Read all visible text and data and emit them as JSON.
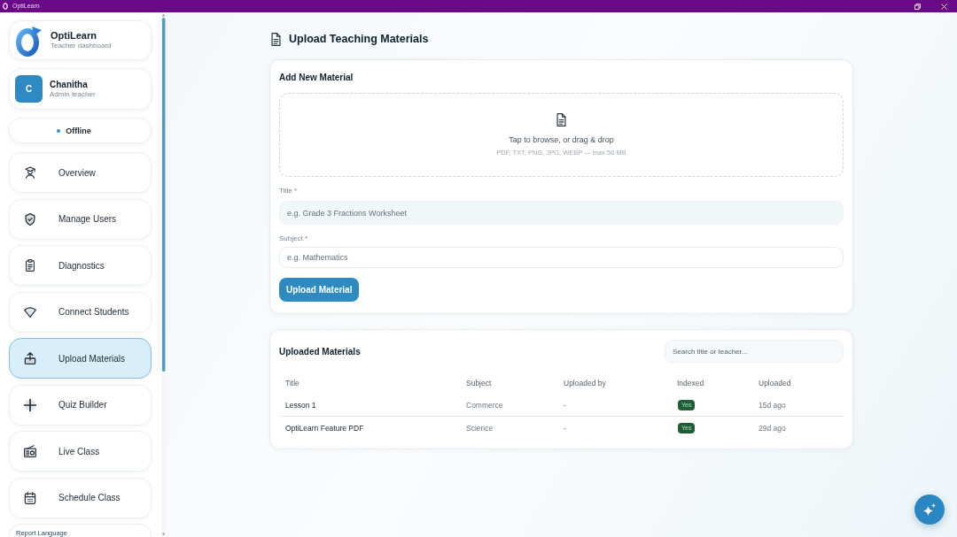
{
  "window": {
    "title": "OptiLearn"
  },
  "sidebar": {
    "brand": {
      "name": "OptiLearn",
      "subtitle": "Teacher dashboard"
    },
    "user": {
      "initial": "C",
      "name": "Chanitha",
      "role": "Admin teacher"
    },
    "status": {
      "label": "Offline"
    },
    "items": [
      {
        "label": "Overview",
        "selected": false
      },
      {
        "label": "Manage Users",
        "selected": false
      },
      {
        "label": "Diagnostics",
        "selected": false
      },
      {
        "label": "Connect Students",
        "selected": false
      },
      {
        "label": "Upload Materials",
        "selected": true
      },
      {
        "label": "Quiz Builder",
        "selected": false
      },
      {
        "label": "Live Class",
        "selected": false
      },
      {
        "label": "Schedule Class",
        "selected": false
      }
    ],
    "footer_item": {
      "label": "Report Language"
    }
  },
  "page": {
    "title": "Upload Teaching Materials"
  },
  "upload_form": {
    "heading": "Add New Material",
    "dropzone": {
      "prompt": "Tap to browse, or drag & drop",
      "hint": "PDF, TXT, PNG, JPG, WEBP — max 50 MB"
    },
    "fields": [
      {
        "label": "Title *",
        "placeholder": "e.g. Grade 3 Fractions Worksheet",
        "focused": true
      },
      {
        "label": "Subject *",
        "placeholder": "e.g. Mathematics",
        "focused": false
      }
    ],
    "submit": "Upload Material"
  },
  "materials": {
    "heading": "Uploaded Materials",
    "search": {
      "placeholder": "Search title or teacher..."
    },
    "columns": [
      "Title",
      "Subject",
      "Uploaded by",
      "Indexed",
      "Uploaded"
    ],
    "rows": [
      {
        "title": "Lesson 1",
        "subject": "Commerce",
        "uploaded_by": "-",
        "indexed": "Yes",
        "uploaded": "15d ago"
      },
      {
        "title": "OptiLearn Feature PDF",
        "subject": "Science",
        "uploaded_by": "-",
        "indexed": "Yes",
        "uploaded": "29d ago"
      }
    ]
  }
}
